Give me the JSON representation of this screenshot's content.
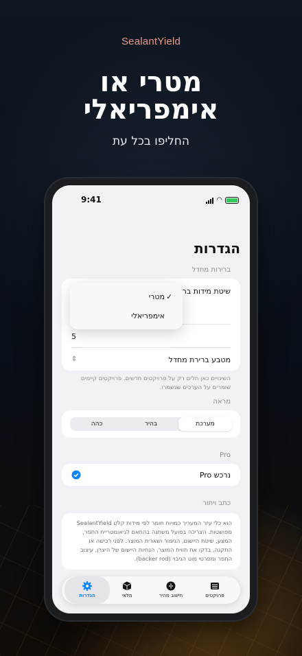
{
  "brand": "SealantYield",
  "headline": {
    "line1": "מטרי או",
    "line2": "אימפריאלי"
  },
  "subline": "החליפו בכל עת",
  "status_bar": {
    "time": "9:41"
  },
  "settings": {
    "title": "הגדרות",
    "defaults_section": "ברירות מחדל",
    "unit_system_label": "שיטת מידות ברי",
    "unit_menu": {
      "options": [
        "מטרי",
        "אימפריאלי"
      ],
      "selected": "מטרי"
    },
    "default_value": "5",
    "default_currency_label": "מטבע ברירת מחדל",
    "defaults_note": "השינויים כאן חלים רק על פרויקטים חדשים. פרויקטים קיימים שומרים על הערכים שנשמרו.",
    "appearance_section": "מראה",
    "appearance_options": [
      "מערכת",
      "בהיר",
      "כהה"
    ],
    "appearance_selected": "מערכת",
    "pro_section": "Pro",
    "pro_row": "נרכש Pro",
    "about_section": "כתב ויתור",
    "about_text": "הוא כלי עזר המעריך כמויות חומר לפי מידות קלט SealantYield מפושטות. הצריכה בפועל משתנה בהתאם לגיאומטריית התפר, המצע, שיטת היישום, הגימור ושארית המוצר. לפני רכישה או התקנה, בדקו את תווית המוצר, הנחיות היישום של היצרן, עיצוב התפר ומפרטי מוט הגיבוי (backer rod)."
  },
  "tabbar": [
    {
      "label": "פרויקטים",
      "icon": "projects-icon"
    },
    {
      "label": "חישוב מהיר",
      "icon": "quick-calc-icon"
    },
    {
      "label": "מלאי",
      "icon": "inventory-box-icon"
    },
    {
      "label": "הגדרות",
      "icon": "gear-icon"
    }
  ],
  "colors": {
    "accent": "#0a84ff",
    "brand": "#e79a8e",
    "battery": "#34c759"
  }
}
